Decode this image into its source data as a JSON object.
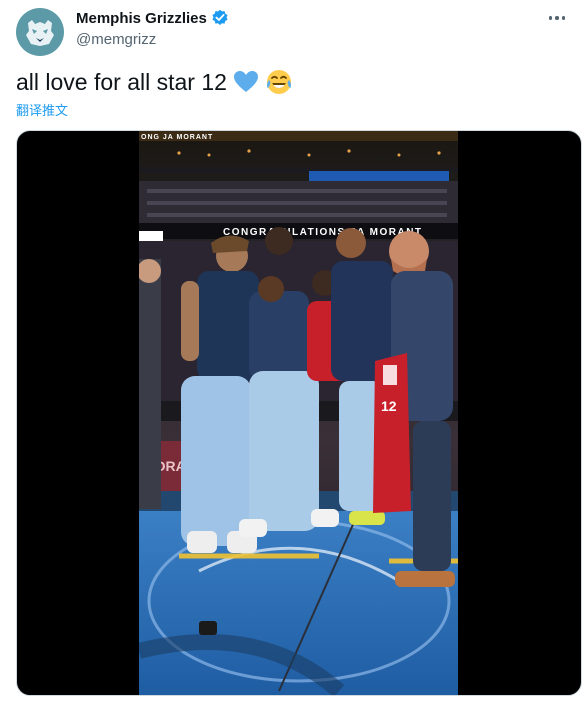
{
  "account": {
    "display_name": "Memphis Grizzlies",
    "handle": "@memgrizz",
    "verified_icon": "verified-badge-icon",
    "avatar_icon": "grizzly-bear-logo-icon"
  },
  "tweet": {
    "text": "all love for all star 12",
    "emojis": [
      "blue-heart-icon",
      "face-with-tears-of-joy-icon"
    ],
    "translate_label": "翻译推文"
  },
  "media": {
    "type": "video",
    "banner_top": "ONG JA MORANT",
    "banner_mid": "CONGRATULATIONS JA MORANT",
    "courtside_text": "MORANT"
  },
  "colors": {
    "link": "#1d9bf0",
    "verified": "#1d9bf0",
    "avatar_bg": "#5d9aa8",
    "court_blue": "#2a6fb8",
    "jersey_red": "#c8202a"
  }
}
